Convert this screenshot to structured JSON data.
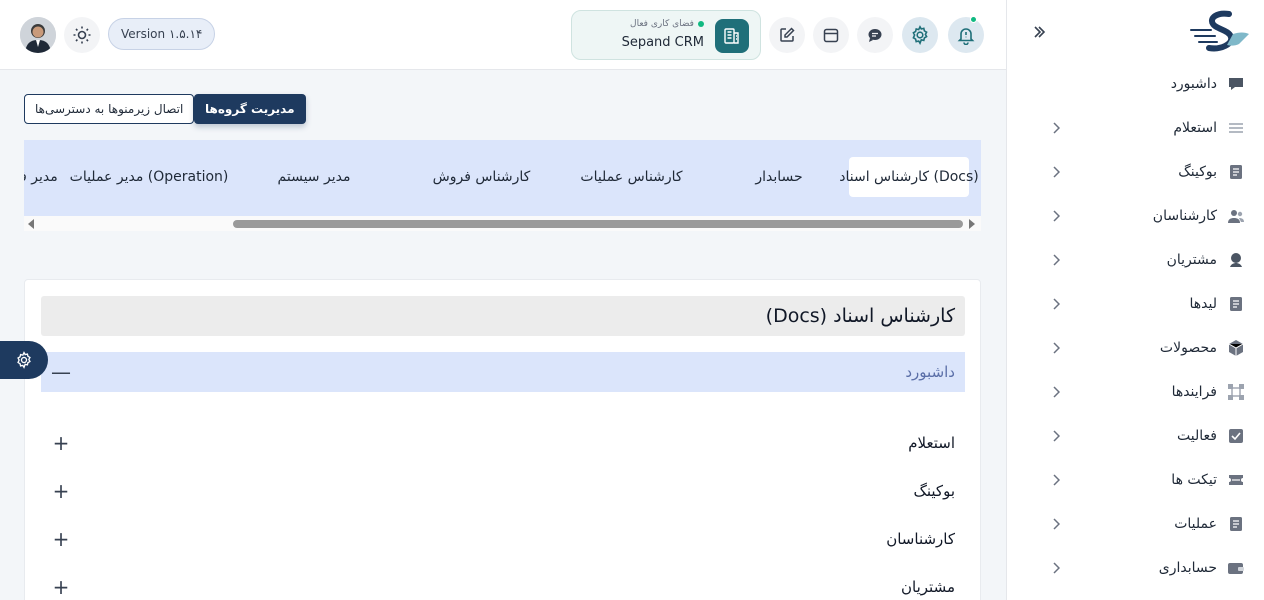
{
  "colors": {
    "primary": "#1e3a5f",
    "workspace_accent": "#1f6f79",
    "active_bg": "#dbe5fb",
    "status_dot": "#10b981"
  },
  "header": {
    "version": "Version ۱.۵.۱۴",
    "workspace": {
      "status": "فضای کاری فعال",
      "name": "Sepand CRM",
      "icon": "document-building-icon"
    },
    "buttons": [
      "notification-bell-icon",
      "gear-icon",
      "chat-icon",
      "calendar-icon",
      "edit-icon"
    ]
  },
  "sidebar": {
    "items": [
      {
        "label": "داشبورد",
        "icon": "chat-bubble-icon",
        "has_children": false
      },
      {
        "label": "استعلام",
        "icon": "list-lines-icon",
        "has_children": true
      },
      {
        "label": "بوکینگ",
        "icon": "document-icon",
        "has_children": true
      },
      {
        "label": "کارشناسان",
        "icon": "users-icon",
        "has_children": true
      },
      {
        "label": "مشتریان",
        "icon": "user-icon",
        "has_children": true
      },
      {
        "label": "لیدها",
        "icon": "document-icon",
        "has_children": true
      },
      {
        "label": "محصولات",
        "icon": "box-icon",
        "has_children": true
      },
      {
        "label": "فرایندها",
        "icon": "process-icon",
        "has_children": true
      },
      {
        "label": "فعالیت",
        "icon": "checkbox-icon",
        "has_children": true
      },
      {
        "label": "تیکت ها",
        "icon": "ticket-icon",
        "has_children": true
      },
      {
        "label": "عملیات",
        "icon": "document-icon",
        "has_children": true
      },
      {
        "label": "حسابداری",
        "icon": "wallet-icon",
        "has_children": true
      }
    ]
  },
  "toolbar": {
    "connect_submenus": "اتصال زیرمنوها به دسترسی‌ها",
    "manage_groups": "مدیریت گروه‌ها"
  },
  "tabs": [
    {
      "label": "کارشناس اسناد (Docs)",
      "active": true
    },
    {
      "label": "حسابدار",
      "active": false
    },
    {
      "label": "کارشناس عملیات",
      "active": false
    },
    {
      "label": "کارشناس فروش",
      "active": false
    },
    {
      "label": "مدیر سیستم",
      "active": false
    },
    {
      "label": "مدیر عملیات (Operation)",
      "active": false
    },
    {
      "label": "مدیر فـ",
      "active": false
    }
  ],
  "group": {
    "title": "کارشناس اسناد (Docs)",
    "sections": [
      {
        "label": "داشبورد",
        "expanded": true,
        "toggle": "—"
      },
      {
        "label": "استعلام",
        "expanded": false,
        "toggle": "+"
      },
      {
        "label": "بوکینگ",
        "expanded": false,
        "toggle": "+"
      },
      {
        "label": "کارشناسان",
        "expanded": false,
        "toggle": "+"
      },
      {
        "label": "مشتریان",
        "expanded": false,
        "toggle": "+"
      }
    ]
  }
}
